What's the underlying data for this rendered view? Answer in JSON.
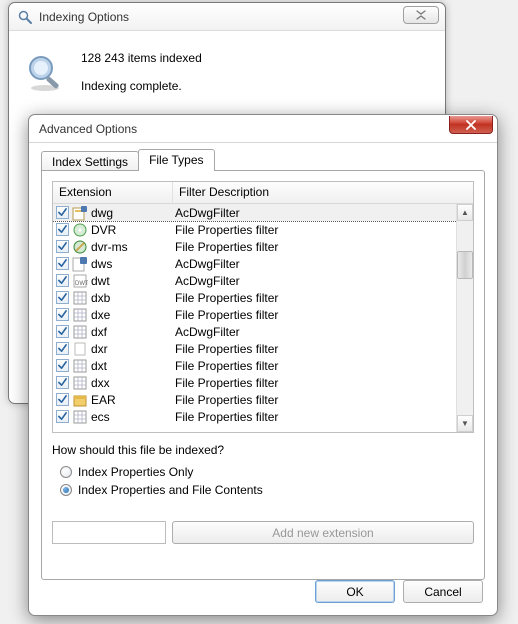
{
  "back": {
    "title": "Indexing Options",
    "items_indexed": "128 243 items indexed",
    "status": "Indexing complete."
  },
  "front": {
    "title": "Advanced Options",
    "tabs": {
      "settings": "Index Settings",
      "filetypes": "File Types"
    },
    "columns": {
      "ext": "Extension",
      "desc": "Filter Description"
    },
    "rows": [
      {
        "ext": "dwg",
        "desc": "AcDwgFilter",
        "selected": true,
        "icon": "dwg"
      },
      {
        "ext": "DVR",
        "desc": "File Properties filter",
        "icon": "disc"
      },
      {
        "ext": "dvr-ms",
        "desc": "File Properties filter",
        "icon": "disc2"
      },
      {
        "ext": "dws",
        "desc": "AcDwgFilter",
        "icon": "dws"
      },
      {
        "ext": "dwt",
        "desc": "AcDwgFilter",
        "icon": "dwt"
      },
      {
        "ext": "dxb",
        "desc": "File Properties filter",
        "icon": "grid"
      },
      {
        "ext": "dxe",
        "desc": "File Properties filter",
        "icon": "grid"
      },
      {
        "ext": "dxf",
        "desc": "AcDwgFilter",
        "icon": "grid"
      },
      {
        "ext": "dxr",
        "desc": "File Properties filter",
        "icon": "blank"
      },
      {
        "ext": "dxt",
        "desc": "File Properties filter",
        "icon": "grid"
      },
      {
        "ext": "dxx",
        "desc": "File Properties filter",
        "icon": "grid"
      },
      {
        "ext": "EAR",
        "desc": "File Properties filter",
        "icon": "archive"
      },
      {
        "ext": "ecs",
        "desc": "File Properties filter",
        "icon": "grid"
      }
    ],
    "question": "How should this file be indexed?",
    "radio1": "Index Properties Only",
    "radio2": "Index Properties and File Contents",
    "add_btn": "Add new extension",
    "ok": "OK",
    "cancel": "Cancel"
  }
}
